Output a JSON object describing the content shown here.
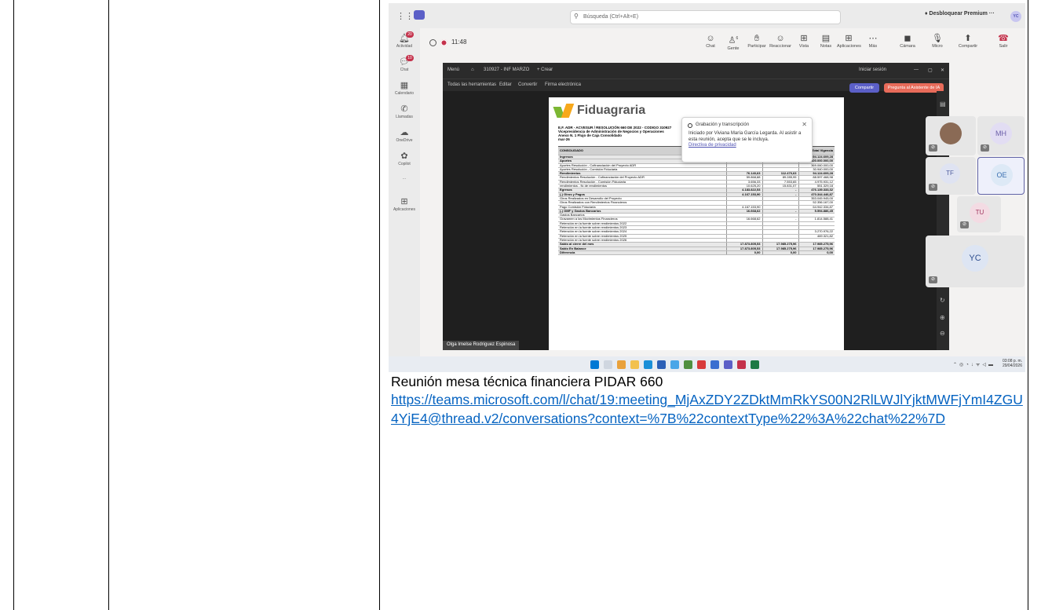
{
  "teams": {
    "search_placeholder": "Búsqueda (Ctrl+Alt+E)",
    "premium_label": "Desbloquear Premium",
    "more_dots": "···",
    "user_initials": "YC",
    "rail": [
      {
        "label": "Actividad",
        "badge": "20"
      },
      {
        "label": "Chat",
        "badge": "10"
      },
      {
        "label": "Calendario"
      },
      {
        "label": "Llamadas"
      },
      {
        "label": "OneDrive"
      },
      {
        "label": "Copilot"
      },
      {
        "label": "..."
      },
      {
        "label": "Aplicaciones"
      }
    ],
    "recording_time": "11:48",
    "callbar": [
      "Chat",
      "Gente",
      "Participar",
      "Reaccionar",
      "Vista",
      "Notas",
      "Aplicaciones",
      "Más",
      "Cámara",
      "Micro",
      "Compartir",
      "Salir"
    ],
    "people_count": "6",
    "presenter_name": "Olga Imelse Rodriguez Espinosa",
    "participants": [
      "MH",
      "TF",
      "OE",
      "TU",
      "YC"
    ],
    "toast": {
      "title": "Grabación y transcripción",
      "body": "Iniciado por Viviana María García Legarda. Al asistir a esta reunión, acepta que se le incluya.",
      "link": "Directiva de privacidad"
    },
    "taskbar_time": "03:08 p. m.",
    "taskbar_date": "29/04/2026"
  },
  "share": {
    "menu": "Menú",
    "doc_title": "310927 - INF MARZO",
    "create": "+ Crear",
    "sign_in": "Iniciar sesión",
    "tools": [
      "Todas las herramientas",
      "Editar",
      "Convertir",
      "Firma electrónica"
    ],
    "btn_share": "Compartir",
    "btn_ai": "Pregunta al Asistente de IA"
  },
  "pdf": {
    "brand": "Fiduagraria",
    "head_lines": [
      "E.F. ADR - ACVESUR / RESOLUCIÓN 660 DE 2022 - CODIGO 310927",
      "Vicepresidencia de Administración de Negocios y Operaciones",
      "Anexo N. 1 Flujo de Caja Consolidado",
      "mar-26"
    ],
    "columns": [
      "CONSOLIDADO",
      "feb-2026",
      "mar-2026",
      "Total Vigencia"
    ],
    "rows": [
      {
        "label": "Ingresos",
        "c1": "21.985.487,42",
        "c2": "17.873.805,53",
        "c3": "494.124.609,28",
        "b": true
      },
      {
        "label": "Aportes",
        "c1": "-",
        "c2": "-",
        "c3": "400.000.000,00",
        "b": true
      },
      {
        "label": "Aportes Resolución - Cofinanciación del Proyecto ADR",
        "c1": "",
        "c2": "",
        "c3": "369.060.000,00"
      },
      {
        "label": "Aportes Resolución - Comisión Fiduciaria",
        "c1": "",
        "c2": "",
        "c3": "30.940.000,00"
      },
      {
        "label": "Rendimientos",
        "c1": "76.140,63",
        "c2": "112.470,63",
        "c3": "94.124.609,28",
        "b": true
      },
      {
        "label": "Rendimientos Resolución - Cofinanciación del Proyecto ADR",
        "c1": "59.868,88",
        "c2": "89.285,95",
        "c3": "88.597.468,98"
      },
      {
        "label": "Rendimientos Resolución - Comisión Fiduciaria",
        "c1": "3.656,33",
        "c2": "7.553,65",
        "c3": "4.975.931,12"
      },
      {
        "label": "rendimientos - fic de rendimientos",
        "c1": "10.625,20",
        "c2": "15.831,07",
        "c3": "551.329,18"
      },
      {
        "label": "Egresos",
        "c1": "4.183.822,53",
        "c2": "-",
        "c3": "476.139.333,32",
        "b": true
      },
      {
        "label": "(-) Giros y Pagos",
        "c1": "4.167.153,90",
        "c2": "-",
        "c3": "470.344.446,87",
        "b": true
      },
      {
        "label": "Giros Realizados en Desarrollo del Proyecto",
        "c1": "",
        "c2": "",
        "c3": "353.045.945,00"
      },
      {
        "label": "Giros Realizados con Rendimientos Financieros",
        "c1": "",
        "c2": "",
        "c3": "52.356.167,00"
      },
      {
        "label": "Pago Comisión Fiduciaria",
        "c1": "4.167.153,90",
        "c2": "",
        "c3": "64.942.334,87"
      },
      {
        "label": "(-) GMF y Gastos Bancarios",
        "c1": "16.668,62",
        "c2": "-",
        "c3": "5.594.886,45",
        "b": true
      },
      {
        "label": "Gastos Bancarios",
        "c1": "",
        "c2": "",
        "c3": ""
      },
      {
        "label": "Gravamen a los Movimientos Financieros",
        "c1": "16.668,62",
        "c2": "-",
        "c3": "1.814.588,41"
      },
      {
        "label": "Retención en la fuente sobre rendimientos 2022",
        "c1": "",
        "c2": "",
        "c3": ""
      },
      {
        "label": "Retención en la fuente sobre rendimientos 2023",
        "c1": "",
        "c2": "",
        "c3": ""
      },
      {
        "label": "Retención en la fuente sobre rendimientos 2024",
        "c1": "",
        "c2": "",
        "c3": "3.270.976,22"
      },
      {
        "label": "Retención en la fuente sobre rendimientos 2025",
        "c1": "",
        "c2": "",
        "c3": "469.321,82"
      },
      {
        "label": "Retención en la fuente sobre rendimientos 2026",
        "c1": "",
        "c2": "",
        "c3": ""
      },
      {
        "label": "Saldo al cierre del mes",
        "c1": "17.873.805,53",
        "c2": "17.985.275,96",
        "c3": "17.985.275,96",
        "b": true
      },
      {
        "label": "Saldo En Balance",
        "c1": "17.873.805,53",
        "c2": "17.985.275,96",
        "c3": "17.985.275,96",
        "b": true
      },
      {
        "label": "Diferencia",
        "c1": "0,00",
        "c2": "0,00",
        "c3": "0,00",
        "b": true
      }
    ]
  },
  "caption": "Reunión mesa técnica financiera PIDAR 660",
  "link_url": "https://teams.microsoft.com/l/chat/19:meeting_MjAxZDY2ZDktMmRkYS00N2RlLWJlYjktMWFjYmI4ZGU4YjE4@thread.v2/conversations?context=%7B%22contextType%22%3A%22chat%22%7D"
}
